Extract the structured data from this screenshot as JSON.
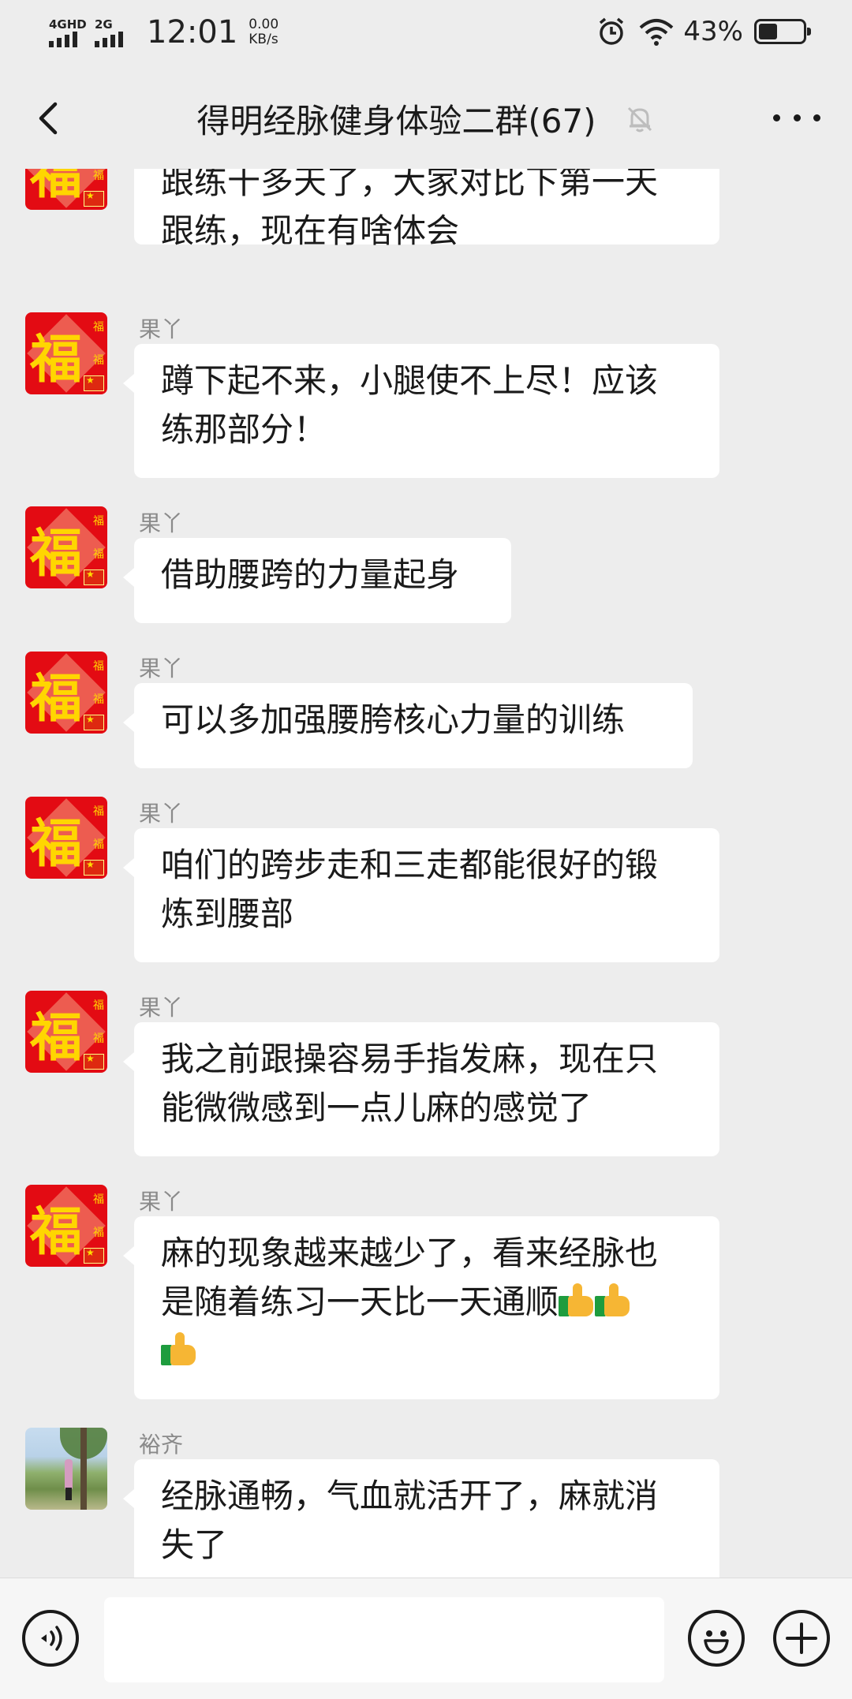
{
  "status_bar": {
    "net1": "4GHD",
    "net2": "2G",
    "time": "12:01",
    "speed_value": "0.00",
    "speed_unit": "KB/s",
    "battery_pct_text": "43%",
    "battery_level": 0.43
  },
  "header": {
    "title": "得明经脉健身体验二群(67)"
  },
  "avatar_char": "福",
  "messages": [
    {
      "sender": "",
      "lines": [
        "跟练十多天了，大家对比下第一天",
        "跟练，现在有啥体会"
      ]
    },
    {
      "sender": "果丫",
      "lines": [
        "蹲下起不来，小腿使不上尽！应该",
        "练那部分！"
      ]
    },
    {
      "sender": "果丫",
      "lines": [
        "借助腰跨的力量起身"
      ]
    },
    {
      "sender": "果丫",
      "lines": [
        "可以多加强腰胯核心力量的训练"
      ]
    },
    {
      "sender": "果丫",
      "lines": [
        "咱们的跨步走和三走都能很好的锻",
        "炼到腰部"
      ]
    },
    {
      "sender": "果丫",
      "lines": [
        "我之前跟操容易手指发麻，现在只",
        "能微微感到一点儿麻的感觉了"
      ]
    },
    {
      "sender": "果丫",
      "lines": [
        "麻的现象越来越少了，看来经脉也",
        "是随着练习一天比一天通顺"
      ]
    },
    {
      "sender": "裕齐",
      "lines": [
        "经脉通畅，气血就活开了，麻就消",
        "失了"
      ]
    }
  ],
  "icons": {
    "back": "chevron-left-icon",
    "mute": "bell-off-icon",
    "more": "more-dots-icon",
    "voice": "voice-icon",
    "emoji": "smiley-icon",
    "plus": "plus-icon",
    "thumbs": "thumbs-up-emoji"
  }
}
